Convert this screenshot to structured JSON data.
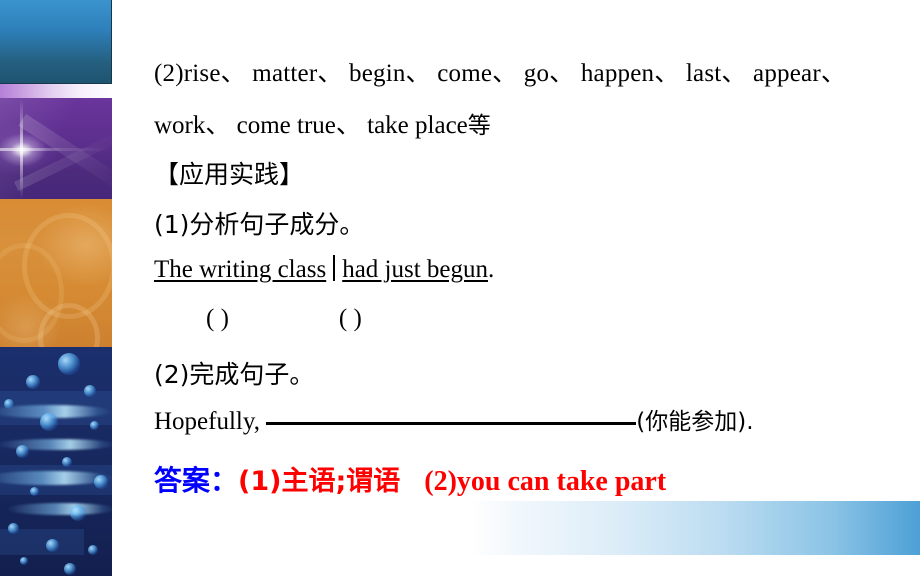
{
  "slide": {
    "verbs_line_1": "(2)rise、  matter、  begin、  come、  go、  happen、  last、  appear、",
    "verbs_line_2": "work、   come true、   take place",
    "verbs_line_2_suffix": "等",
    "section_heading": "【应用实践】",
    "task_1": "(1)分析句子成分。",
    "parse_subject": "The writing class",
    "parse_predicate": "had just begun",
    "parse_end_punct": ".",
    "paren_left": "(        )",
    "paren_right": "(        )",
    "task_2": "(2)完成句子。",
    "fill_prefix": "Hopefully, ",
    "fill_suffix": "(你能参加).",
    "answer_label": "答案：",
    "answer_part_1": "(1)主语;谓语",
    "answer_part_2": "(2)you can take part"
  },
  "colors": {
    "answer_label_color": "#0000ff",
    "answer_body_color": "#ff0000",
    "sidebar_top_blue": "#3b93cd",
    "sidebar_purple": "#5d2f8e",
    "sidebar_orange": "#d8903c",
    "sidebar_deep_blue": "#1a2c66",
    "bottom_bar_accent": "#4da0d6"
  }
}
